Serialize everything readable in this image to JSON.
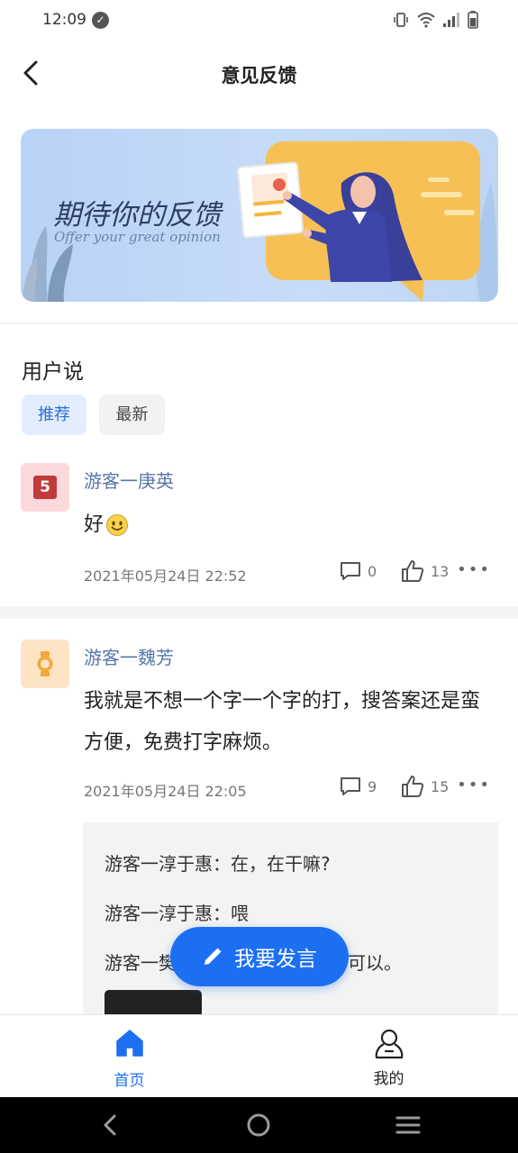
{
  "status": {
    "time": "12:09"
  },
  "header": {
    "title": "意见反馈"
  },
  "banner": {
    "title": "期待你的反馈",
    "subtitle": "Offer your great opinion"
  },
  "section": {
    "title": "用户说"
  },
  "tabs": [
    {
      "label": "推荐"
    },
    {
      "label": "最新"
    }
  ],
  "posts": [
    {
      "avatar_text": "5",
      "user": "游客一庚英",
      "body": "好",
      "time": "2021年05月24日 22:52",
      "comments": "0",
      "likes": "13"
    },
    {
      "user": "游客一魏芳",
      "body": "我就是不想一个字一个字的打，搜答案还是蛮方便，免费打字麻烦。",
      "time": "2021年05月24日 22:05",
      "comments": "9",
      "likes": "15",
      "replies": [
        "游客一淳于惠：在，在干嘛?",
        "游客一淳于惠：喂",
        "游客一樊",
        "可以。"
      ]
    }
  ],
  "fab": {
    "label": "我要发言"
  },
  "nav": {
    "home": "首页",
    "mine": "我的"
  },
  "colors": {
    "accent": "#1d6ff2",
    "username": "#5677a9"
  }
}
